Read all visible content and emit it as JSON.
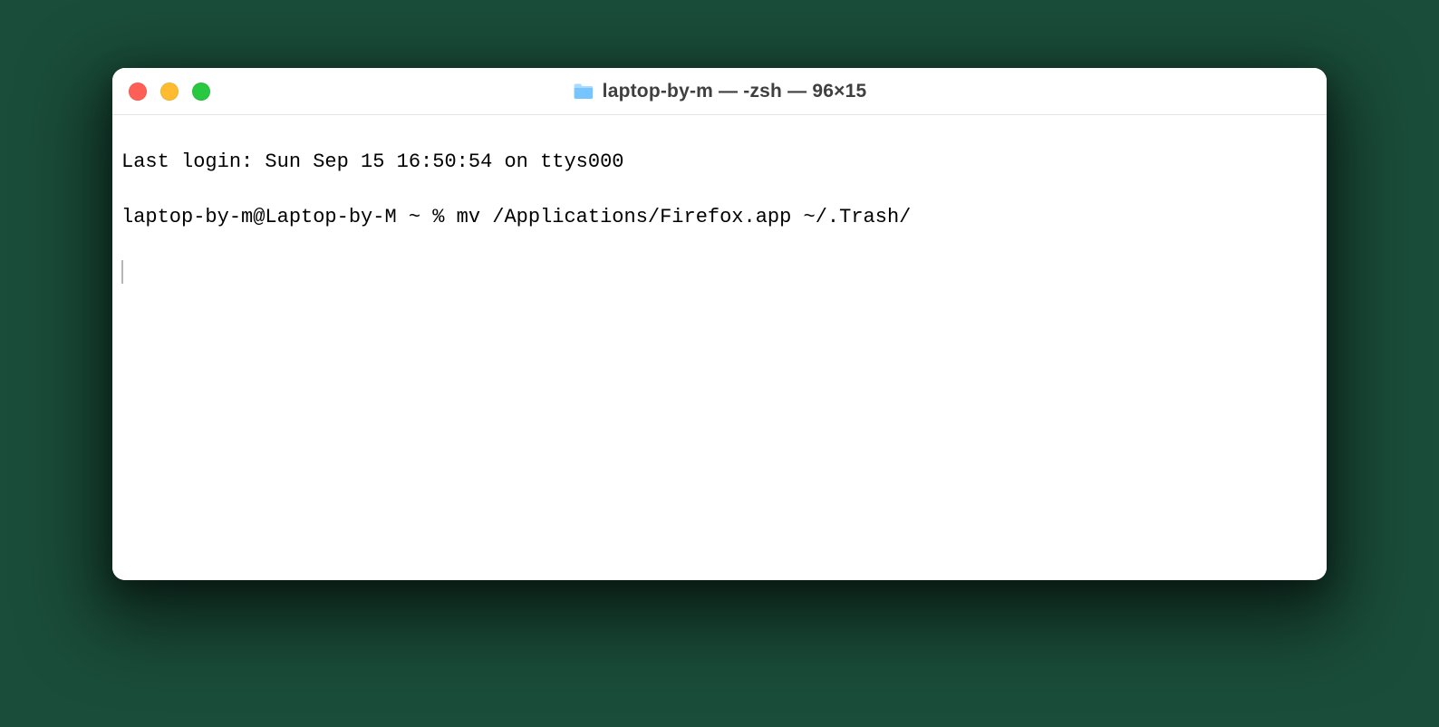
{
  "window": {
    "title": "laptop-by-m — -zsh — 96×15"
  },
  "terminal": {
    "lines": [
      "Last login: Sun Sep 15 16:50:54 on ttys000",
      "laptop-by-m@Laptop-by-M ~ % mv /Applications/Firefox.app ~/.Trash/"
    ]
  },
  "colors": {
    "traffic_red": "#ff5f57",
    "traffic_yellow": "#febc2e",
    "traffic_green": "#28c840",
    "folder_icon": "#76c5ff"
  }
}
